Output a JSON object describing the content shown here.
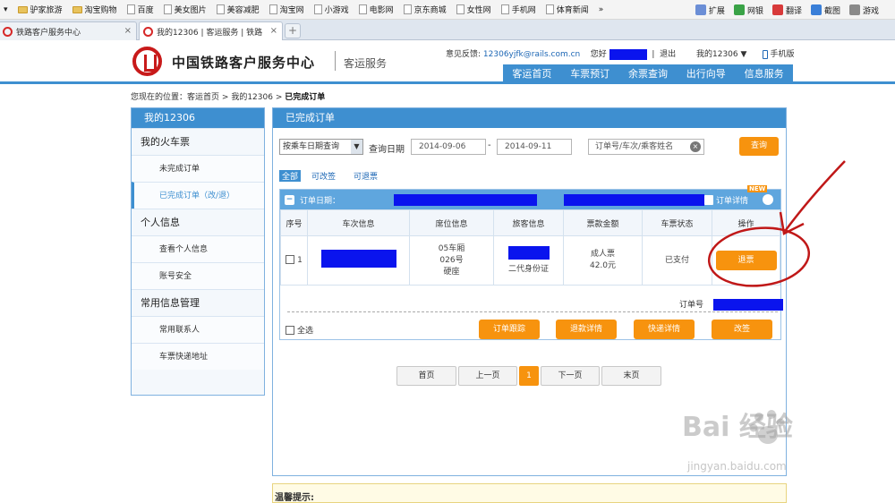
{
  "bookmarks": {
    "items": [
      {
        "label": "驴家旅游",
        "icon": "folder-icon"
      },
      {
        "label": "淘宝购物",
        "icon": "folder-icon"
      },
      {
        "label": "百度",
        "icon": "page-icon"
      },
      {
        "label": "美女图片",
        "icon": "page-icon"
      },
      {
        "label": "美容减肥",
        "icon": "page-icon"
      },
      {
        "label": "淘宝网",
        "icon": "page-icon"
      },
      {
        "label": "小游戏",
        "icon": "page-icon"
      },
      {
        "label": "电影网",
        "icon": "page-icon"
      },
      {
        "label": "京东商城",
        "icon": "page-icon"
      },
      {
        "label": "女性网",
        "icon": "page-icon"
      },
      {
        "label": "手机网",
        "icon": "page-icon"
      },
      {
        "label": "体育新闻",
        "icon": "page-icon"
      }
    ],
    "more": "»",
    "right": [
      {
        "label": "扩展",
        "color": "#6b8ed6"
      },
      {
        "label": "网银",
        "color": "#3aa347"
      },
      {
        "label": "翻译",
        "color": "#d83a3a"
      },
      {
        "label": "截图",
        "color": "#3a7fd8"
      },
      {
        "label": "游戏",
        "color": "#8a8a8a"
      }
    ]
  },
  "tabs": [
    {
      "label": "铁路客户服务中心"
    },
    {
      "label": "我的12306 | 客运服务 | 铁路"
    }
  ],
  "header": {
    "title": "中国铁路客户服务中心",
    "subtitle": "客运服务",
    "feedback_label": "意见反馈:",
    "feedback_email": "12306yjfk@rails.com.cn",
    "greeting": "您好",
    "logout": "退出",
    "my12306": "我的12306",
    "mobile": "手机版",
    "nav": [
      "客运首页",
      "车票预订",
      "余票查询",
      "出行向导",
      "信息服务"
    ]
  },
  "breadcrumb": {
    "prefix": "您现在的位置：客运首页",
    "sep": ">",
    "mid": "我的12306",
    "current": "已完成订单"
  },
  "sidebar": {
    "title": "我的12306",
    "groups": [
      {
        "title": "我的火车票",
        "items": [
          "未完成订单",
          "已完成订单（改/退）"
        ]
      },
      {
        "title": "个人信息",
        "items": [
          "查看个人信息",
          "账号安全"
        ]
      },
      {
        "title": "常用信息管理",
        "items": [
          "常用联系人",
          "车票快递地址"
        ]
      }
    ],
    "active_item": "已完成订单（改/退）"
  },
  "main": {
    "title": "已完成订单",
    "query_type": "按乘车日期查询",
    "query_date_label": "查询日期",
    "date_from": "2014-09-06",
    "date_to": "2014-09-11",
    "date_sep": "-",
    "search_placeholder": "订单号/车次/乘客姓名",
    "query_button": "查询",
    "filters": [
      "全部",
      "可改签",
      "可退票"
    ],
    "order_date_label": "订单日期：",
    "order_detail": "订单详情",
    "new_badge": "NEW",
    "columns": [
      "序号",
      "车次信息",
      "席位信息",
      "旅客信息",
      "票款金额",
      "车票状态",
      "操作"
    ],
    "row": {
      "index": "1",
      "seat_car": "05车厢",
      "seat_no": "026号",
      "seat_type": "硬座",
      "id_type": "二代身份证",
      "ticket_type": "成人票",
      "price": "42.0元",
      "status": "已支付",
      "action": "退票"
    },
    "order_no_label": "订单号",
    "select_all": "全选",
    "actions": [
      "订单跟踪",
      "退款详情",
      "快递详情",
      "改签"
    ]
  },
  "pager": [
    "首页",
    "上一页",
    "1",
    "下一页",
    "末页"
  ],
  "tip": "温馨提示:",
  "watermark": {
    "text": "Bai 经验",
    "url": "jingyan.baidu.com"
  },
  "colors": {
    "accent": "#3e8fd0",
    "orange": "#f7930e",
    "annotation": "#c01818",
    "redaction": "#0a14ee"
  }
}
